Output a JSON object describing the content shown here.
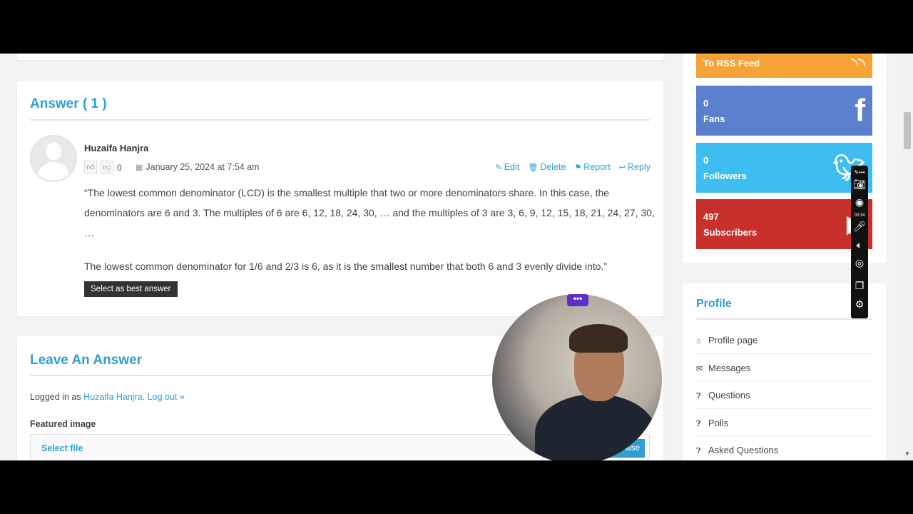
{
  "answer": {
    "heading": "Answer ( 1 )",
    "author": "Huzaifa Hanjra",
    "vote_count": "0",
    "date": "January 25, 2024 at 7:54 am",
    "actions": {
      "edit": "Edit",
      "delete": "Delete",
      "report": "Report",
      "reply": "Reply"
    },
    "paragraph1": "“The lowest common denominator (LCD) is the smallest multiple that two or more denominators share. In this case, the denominators are 6 and 3. The multiples of 6 are 6, 12, 18, 24, 30, … and the multiples of 3 are 3, 6, 9, 12, 15, 18, 21, 24, 27, 30, …",
    "paragraph2": "The lowest common denominator for 1/6 and 2/3 is 6, as it is the smallest number that both 6 and 3 evenly divide into.”",
    "best_button": "Select as best answer"
  },
  "leave": {
    "heading": "Leave An Answer",
    "logged_prefix": "Logged in as ",
    "logged_user": "Huzaifa Hanjra",
    "logout": "Log out »",
    "featured_label": "Featured image",
    "select_file": "Select file",
    "browse": "owse"
  },
  "social": {
    "rss": {
      "label": "To RSS Feed",
      "icon": "rss-icon"
    },
    "facebook": {
      "count": "0",
      "label": "Fans",
      "icon": "facebook-icon"
    },
    "twitter": {
      "count": "0",
      "label": "Followers",
      "icon": "twitter-icon"
    },
    "youtube": {
      "count": "497",
      "label": "Subscribers",
      "icon": "youtube-icon"
    }
  },
  "profile": {
    "title": "Profile",
    "items": [
      {
        "label": "Profile page",
        "icon": "home-icon"
      },
      {
        "label": "Messages",
        "icon": "envelope-icon"
      },
      {
        "label": "Questions",
        "icon": "question-icon"
      },
      {
        "label": "Polls",
        "icon": "question-icon"
      },
      {
        "label": "Asked Questions",
        "icon": "question-icon"
      }
    ]
  },
  "recorder": {
    "timer": "00:34"
  },
  "colors": {
    "accent": "#2e9fd5",
    "rss": "#f6a236",
    "facebook": "#5b7fcd",
    "twitter": "#3ebdf0",
    "youtube": "#c8302b"
  }
}
